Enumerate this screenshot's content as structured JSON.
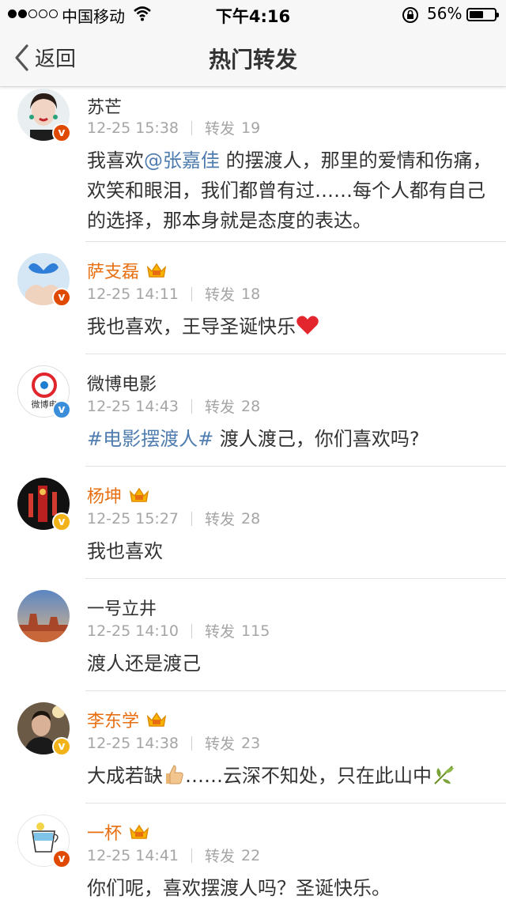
{
  "status_bar": {
    "carrier": "中国移动",
    "time": "下午4:16",
    "battery_percent": "56%",
    "battery_level": 0.56,
    "signal_bars_filled": 2,
    "signal_bars_total": 5
  },
  "nav": {
    "back_label": "返回",
    "title": "热门转发"
  },
  "colors": {
    "vip_name": "#e86f11",
    "link": "#507daf",
    "meta": "#a5a5a5",
    "badge_orange": "#e04a00",
    "badge_yellow": "#f2b318",
    "badge_blue": "#3a8ed9"
  },
  "reposts": [
    {
      "name": "苏芒",
      "vip": false,
      "badge": "orange",
      "time": "12-25 15:38",
      "repost_label": "转发",
      "repost_count": "19",
      "text_pre": "我喜欢",
      "mention": "@张嘉佳",
      "text_post": " 的摆渡人，那里的爱情和伤痛，欢笑和眼泪，我们都曾有过……每个人都有自己的选择，那本身就是态度的表达。"
    },
    {
      "name": "萨支磊",
      "vip": true,
      "badge": "orange",
      "time": "12-25 14:11",
      "repost_label": "转发",
      "repost_count": "18",
      "text": "我也喜欢，王导圣诞快乐",
      "emoji": "heart-icon"
    },
    {
      "name": "微博电影",
      "vip": false,
      "badge": "blue",
      "time": "12-25 14:43",
      "repost_label": "转发",
      "repost_count": "28",
      "topic": "#电影摆渡人#",
      "text": " 渡人渡己，你们喜欢吗?",
      "avatar_text": "微博电"
    },
    {
      "name": "杨坤",
      "vip": true,
      "badge": "yellow",
      "time": "12-25 15:27",
      "repost_label": "转发",
      "repost_count": "28",
      "text": "我也喜欢"
    },
    {
      "name": "一号立井",
      "vip": false,
      "badge": "",
      "time": "12-25 14:10",
      "repost_label": "转发",
      "repost_count": "115",
      "text": "渡人还是渡己"
    },
    {
      "name": "李东学",
      "vip": true,
      "badge": "yellow",
      "time": "12-25 14:38",
      "repost_label": "转发",
      "repost_count": "23",
      "text_pre": "大成若缺",
      "text_post": "……云深不知处，只在此山中",
      "emoji1": "thumbs-up-icon",
      "emoji2": "bamboo-leaf-icon"
    },
    {
      "name": "一杯",
      "vip": true,
      "badge": "orange",
      "time": "12-25 14:41",
      "repost_label": "转发",
      "repost_count": "22",
      "text": "你们呢，喜欢摆渡人吗？圣诞快乐。"
    }
  ]
}
